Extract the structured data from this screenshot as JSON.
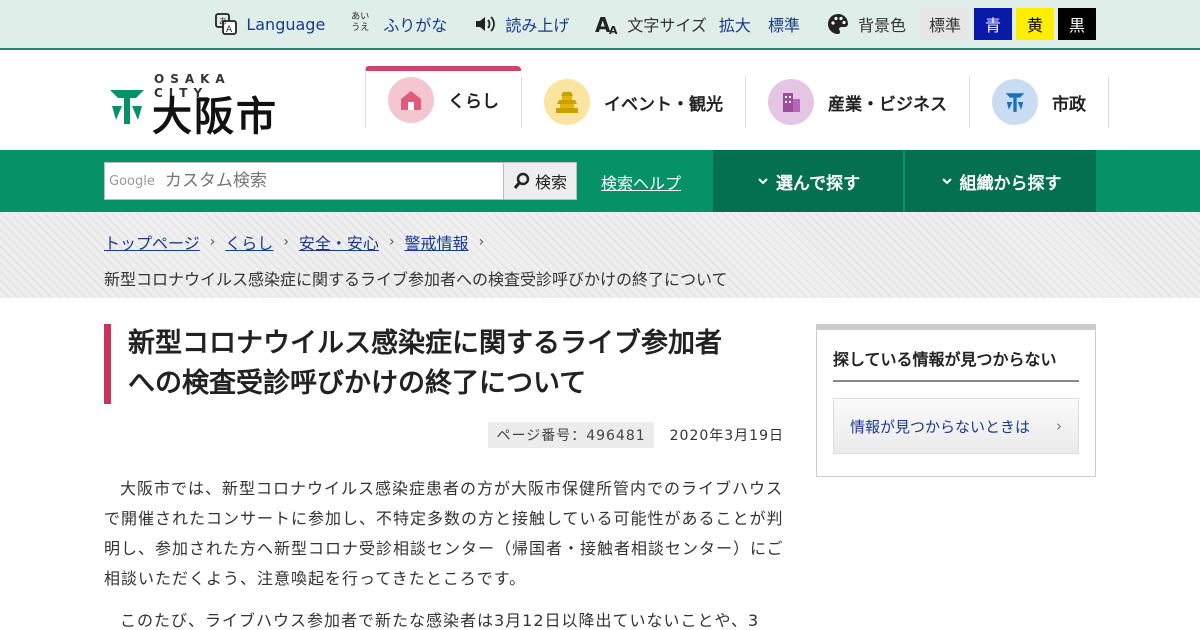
{
  "utility": {
    "language": "Language",
    "furigana_icon": "あいうえ",
    "furigana": "ふりがな",
    "read_aloud": "読み上げ",
    "font_size_label": "文字サイズ",
    "font_enlarge": "拡大",
    "font_standard": "標準",
    "bg_color_label": "背景色",
    "bg_standard": "標準",
    "bg_blue": "青",
    "bg_yellow": "黄",
    "bg_black": "黒"
  },
  "header": {
    "logo_city": "OSAKA CITY",
    "logo_name": "大阪市",
    "nav": [
      {
        "label": "くらし",
        "color": "#f4c6d0"
      },
      {
        "label": "イベント・観光",
        "color": "#fbe4a0"
      },
      {
        "label": "産業・ビジネス",
        "color": "#e4c6e4"
      },
      {
        "label": "市政",
        "color": "#c8dcf2"
      }
    ]
  },
  "search": {
    "google_label": "Google",
    "placeholder": "カスタム検索",
    "button": "検索",
    "help": "検索ヘルプ",
    "browse": "選んで探す",
    "org": "組織から探す"
  },
  "breadcrumb": {
    "items": [
      "トップページ",
      "くらし",
      "安全・安心",
      "警戒情報"
    ],
    "current": "新型コロナウイルス感染症に関するライブ参加者への検査受診呼びかけの終了について"
  },
  "article": {
    "title_line1": "新型コロナウイルス感染症に関するライブ参加者",
    "title_line2": "への検査受診呼びかけの終了について",
    "page_number": "ページ番号：496481",
    "date": "2020年3月19日",
    "para1": "大阪市では、新型コロナウイルス感染症患者の方が大阪市保健所管内でのライブハウスで開催されたコンサートに参加し、不特定多数の方と接触している可能性があることが判明し、参加された方へ新型コロナ受診相談センター（帰国者・接触者相談センター）にご相談いただくよう、注意喚起を行ってきたところです。",
    "para2": "このたび、ライブハウス参加者で新たな感染者は3月12日以降出ていないことや、3"
  },
  "sidebar": {
    "title": "探している情報が見つからない",
    "link": "情報が見つからないときは"
  }
}
